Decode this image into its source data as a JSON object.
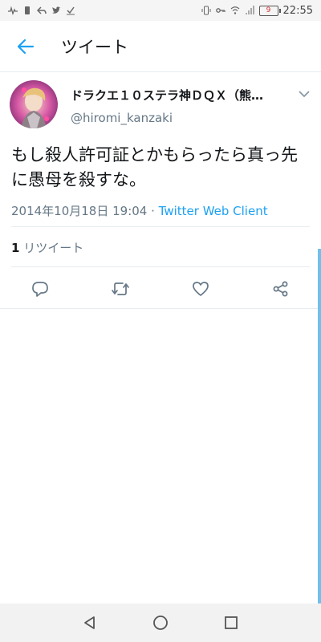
{
  "status_bar": {
    "time": "22:55",
    "battery_level": "9",
    "left_icons": [
      "activity-icon",
      "sim-icon",
      "reply-icon",
      "twitter-icon",
      "check-icon"
    ],
    "right_icons": [
      "vibrate-icon",
      "key-icon",
      "wifi-icon",
      "signal-icon",
      "battery-icon"
    ]
  },
  "header": {
    "title": "ツイート",
    "accent": "#1da1f2"
  },
  "tweet": {
    "author_name": "ドラクエ１０ステラ神ＤＱＸ（熊…",
    "author_handle": "@hiromi_kanzaki",
    "text": "もし殺人許可証とかもらったら真っ先に愚母を殺すな。",
    "timestamp": "2014年10月18日 19:04",
    "separator": " · ",
    "client": "Twitter Web Client",
    "retweet_count": "1",
    "retweet_label": "リツイート"
  },
  "actions": [
    "reply-icon",
    "retweet-icon",
    "like-icon",
    "share-icon"
  ]
}
